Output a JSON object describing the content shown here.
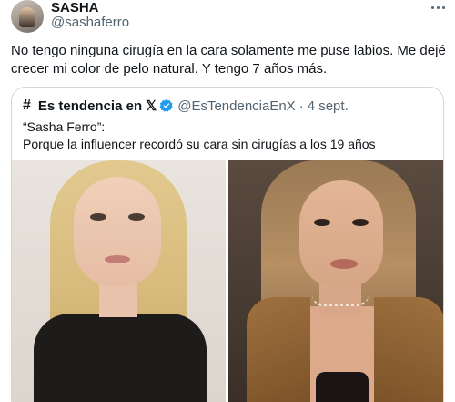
{
  "author": {
    "display_name": "SASHA",
    "handle": "@sashaferro"
  },
  "tweet": {
    "text": "No tengo ninguna cirugía en la cara solamente me puse labios. Me dejé crecer mi color de pelo natural. Y tengo 7 años más."
  },
  "quoted": {
    "hash_icon": "#",
    "name": "Es tendencia en",
    "x_mark": "𝕏",
    "handle": "@EsTendenciaEnX",
    "separator": "·",
    "date": "4 sept.",
    "text_line1": "“Sasha Ferro”:",
    "text_line2": "Porque la influencer recordó su cara sin cirugías a los 19 años"
  },
  "colors": {
    "text": "#0f1419",
    "secondary": "#536471",
    "verified": "#1d9bf0",
    "border": "#cfd9de"
  },
  "icons": {
    "more": "more-horizontal-icon",
    "verified": "verified-badge-icon"
  }
}
